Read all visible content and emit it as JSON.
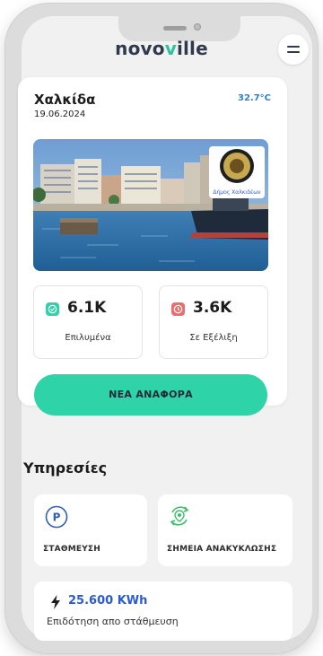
{
  "app": {
    "logo_part1": "novo",
    "logo_accent": "v",
    "logo_part2": "ille"
  },
  "weather": {
    "city": "Χαλκίδα",
    "date": "19.06.2024",
    "temperature": "32.7°C",
    "logo_caption": "Δήμος Χαλκιδέων"
  },
  "stats": {
    "resolved": {
      "value": "6.1K",
      "label": "Επιλυμένα",
      "color": "#2ed3a7"
    },
    "in_progress": {
      "value": "3.6K",
      "label": "Σε Εξέλιξη",
      "color": "#f26b6b"
    }
  },
  "cta": {
    "label": "ΝΕΑ ΑΝΑΦΟΡΑ",
    "color": "#2ed3a7"
  },
  "services": {
    "title": "Υπηρεσίες",
    "items": [
      {
        "label": "ΣΤΑΘΜΕΥΣΗ",
        "icon": "parking-icon",
        "color": "#2f5fb3"
      },
      {
        "label": "ΣΗΜΕΙΑ ΑΝΑΚΥΚΛΩΣΗΣ",
        "icon": "recycling-icon",
        "color": "#3bbf6a"
      }
    ]
  },
  "energy": {
    "value": "25.600 KWh",
    "subtitle": "Επιδότηση απο στάθμευση",
    "icon": "lightning-icon"
  }
}
